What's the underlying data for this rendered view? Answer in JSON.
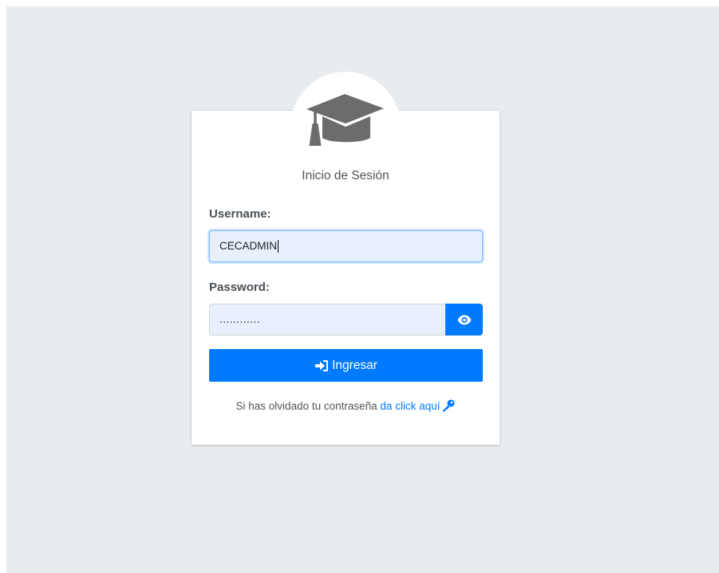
{
  "login": {
    "title": "Inicio de Sesión",
    "username_label": "Username:",
    "username_value": "CECADMIN",
    "password_label": "Password:",
    "password_masked": "............",
    "submit_label": "Ingresar",
    "forgot_text": "Si has olvidado tu contraseña",
    "forgot_link": "da click aquí"
  },
  "icons": {
    "logo": "graduation-cap-icon",
    "toggle_password": "eye-icon",
    "submit": "sign-in-icon",
    "forgot": "key-icon"
  },
  "colors": {
    "background": "#e9ecef",
    "primary": "#007bff",
    "icon_gray": "#6c6c6c",
    "input_autofill": "#e8f0fe"
  }
}
